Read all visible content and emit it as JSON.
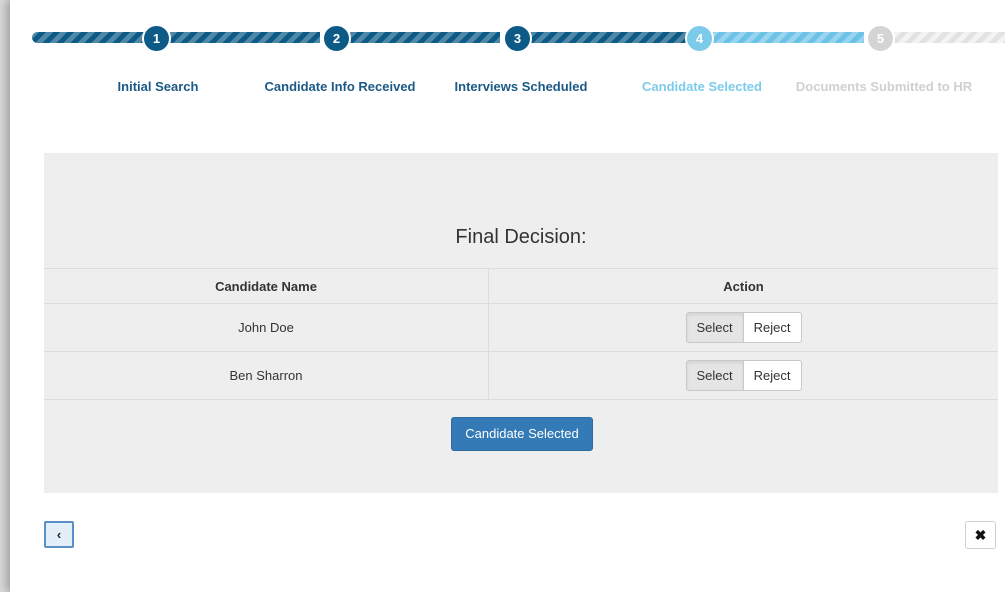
{
  "wizard": {
    "steps": [
      {
        "number": "1",
        "label": "Initial Search",
        "state": "done"
      },
      {
        "number": "2",
        "label": "Candidate Info Received",
        "state": "done"
      },
      {
        "number": "3",
        "label": "Interviews Scheduled",
        "state": "done"
      },
      {
        "number": "4",
        "label": "Candidate Selected",
        "state": "current"
      },
      {
        "number": "5",
        "label": "Documents Submitted to HR",
        "state": "todo"
      }
    ],
    "colors": {
      "done": "#0c5a85",
      "current": "#7ccbeb",
      "todo": "#d4d4d4"
    }
  },
  "decision": {
    "title": "Final Decision:",
    "columns": {
      "name": "Candidate Name",
      "action": "Action"
    },
    "rows": [
      {
        "name": "John Doe",
        "select_label": "Select",
        "reject_label": "Reject",
        "selected": "Select"
      },
      {
        "name": "Ben Sharron",
        "select_label": "Select",
        "reject_label": "Reject",
        "selected": "Select"
      }
    ],
    "submit_label": "Candidate Selected"
  },
  "footer": {
    "back_icon": "chevron-left-icon",
    "back_glyph": "‹",
    "close_icon": "close-icon",
    "close_glyph": "✖"
  }
}
